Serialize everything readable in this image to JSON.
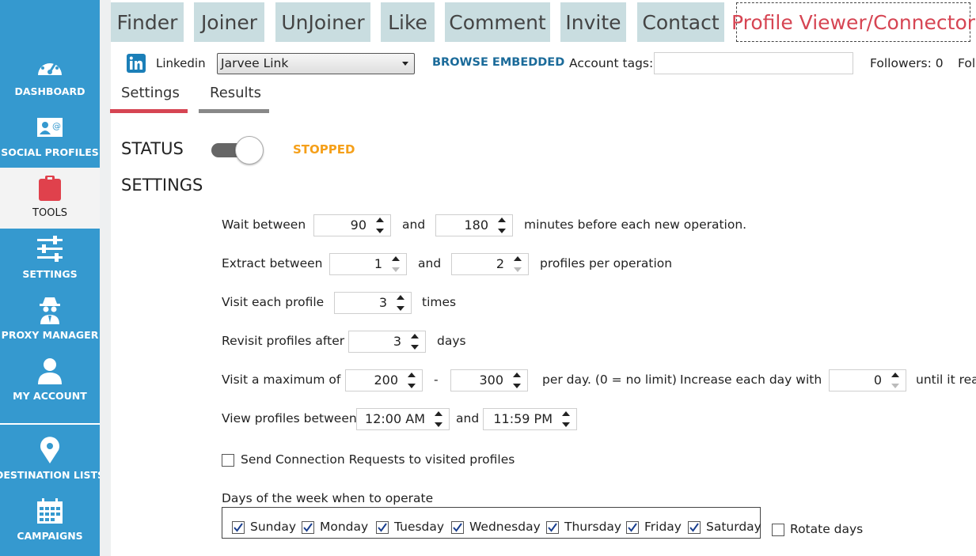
{
  "sidebar": {
    "items": [
      {
        "label": "DASHBOARD",
        "icon": "dashboard-icon"
      },
      {
        "label": "SOCIAL PROFILES",
        "icon": "social-profiles-icon"
      },
      {
        "label": "TOOLS",
        "icon": "tools-icon",
        "active": true
      },
      {
        "label": "SETTINGS",
        "icon": "settings-sliders-icon"
      },
      {
        "label": "PROXY MANAGER",
        "icon": "spy-icon"
      },
      {
        "label": "MY ACCOUNT",
        "icon": "user-icon"
      },
      {
        "label": "DESTINATION LISTS",
        "icon": "map-pin-icon"
      },
      {
        "label": "CAMPAIGNS",
        "icon": "calendar-icon"
      }
    ]
  },
  "tabs": [
    "Finder",
    "Joiner",
    "UnJoiner",
    "Like",
    "Comment",
    "Invite",
    "Contact",
    "Profile Viewer/Connector"
  ],
  "account_bar": {
    "network": "Linkedin",
    "account": "Jarvee Link",
    "browse": "BROWSE EMBEDDED",
    "tags_label": "Account tags:",
    "tags_value": "",
    "followers": "Followers:  0",
    "following": "Fol"
  },
  "subtabs": {
    "settings": "Settings",
    "results": "Results"
  },
  "status": {
    "label": "STATUS",
    "value": "STOPPED"
  },
  "settings_heading": "SETTINGS",
  "form": {
    "wait": {
      "label": "Wait between",
      "min": "90",
      "and": "and",
      "max": "180",
      "suffix": "minutes before each new operation."
    },
    "extract": {
      "label": "Extract between",
      "min": "1",
      "and": "and",
      "max": "2",
      "suffix": "profiles per operation"
    },
    "visit": {
      "label": "Visit each profile",
      "value": "3",
      "suffix": "times"
    },
    "revisit": {
      "label": "Revisit profiles after",
      "value": "3",
      "suffix": "days"
    },
    "maximum": {
      "label": "Visit a maximum of",
      "min": "200",
      "dash": "-",
      "max": "300",
      "suffix": "per day. (0 = no limit)",
      "increase_label": "Increase each day with",
      "increase": "0",
      "tail": "until it rea"
    },
    "view": {
      "label": "View profiles between",
      "start": "12:00 AM",
      "and": "and",
      "end": "11:59 PM"
    },
    "send_requests": {
      "label": "Send Connection Requests to visited profiles",
      "checked": false
    },
    "days": {
      "label": "Days of the week when to operate",
      "list": [
        {
          "name": "Sunday",
          "checked": true
        },
        {
          "name": "Monday",
          "checked": true
        },
        {
          "name": "Tuesday",
          "checked": true
        },
        {
          "name": "Wednesday",
          "checked": true
        },
        {
          "name": "Thursday",
          "checked": true
        },
        {
          "name": "Friday",
          "checked": true
        },
        {
          "name": "Saturday",
          "checked": true
        }
      ],
      "rotate": {
        "label": "Rotate days",
        "checked": false
      }
    }
  },
  "colors": {
    "sidebar": "#3599cf",
    "tab": "#c9dde0",
    "active_tab_text": "#d64553",
    "stopped": "#f5a01a",
    "browse": "#1b6b9a",
    "settings_underline": "#d64553",
    "results_underline": "#888888"
  }
}
